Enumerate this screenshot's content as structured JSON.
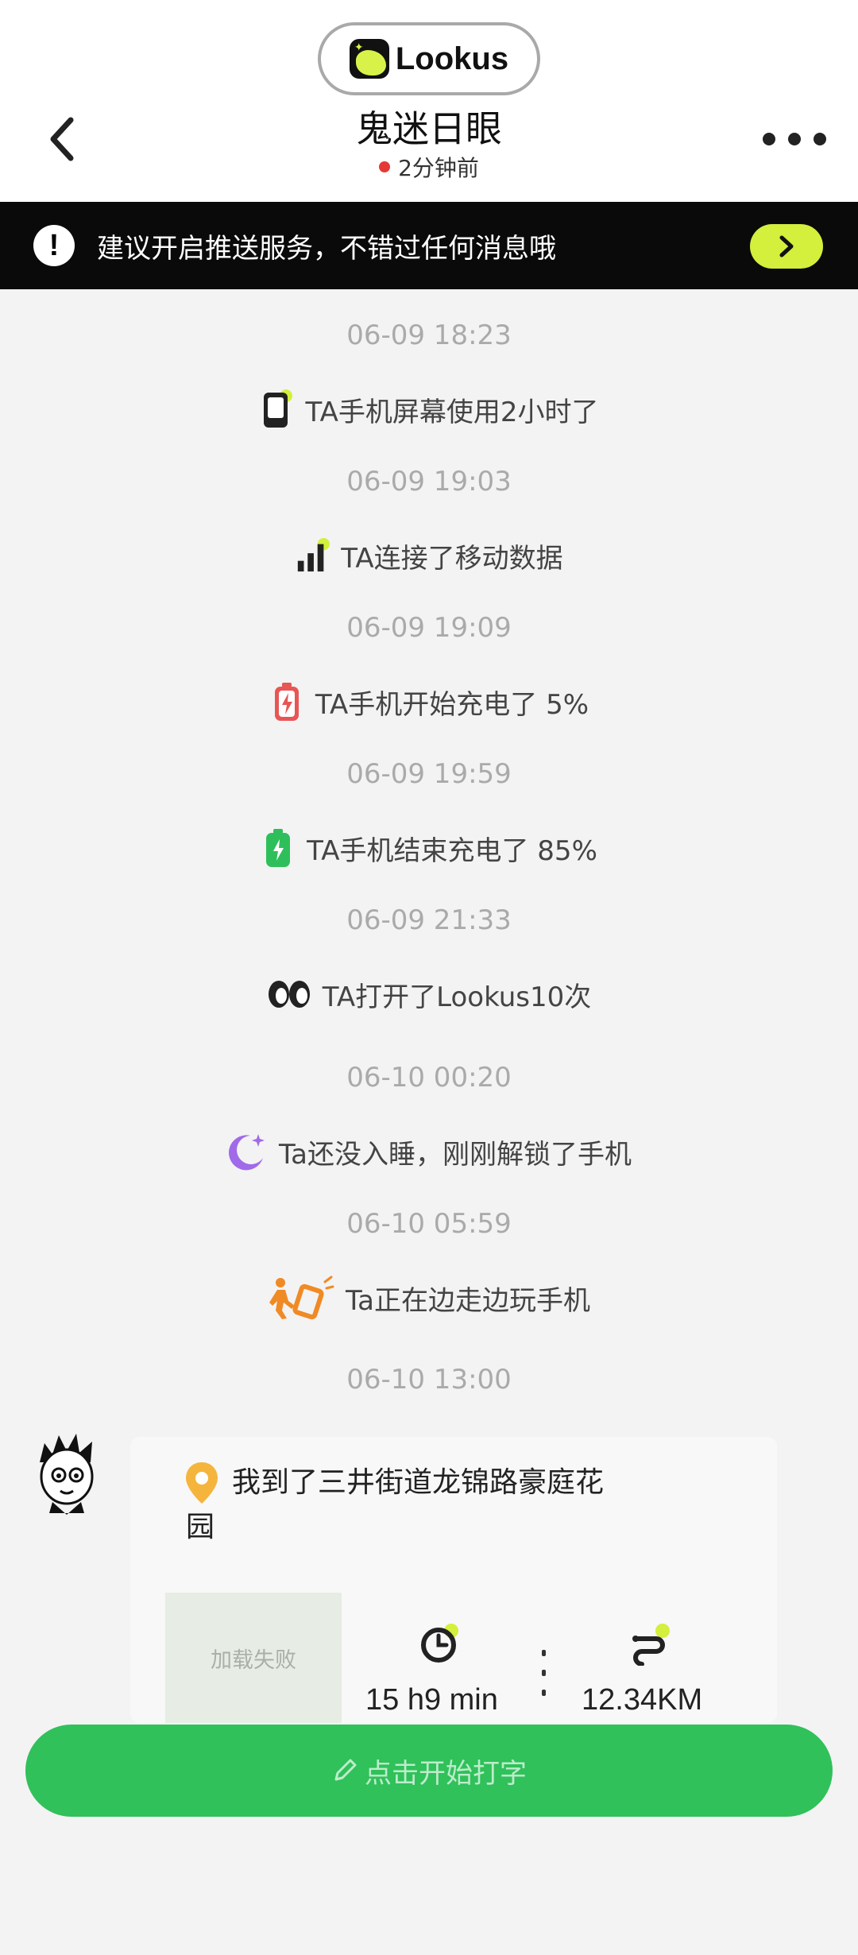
{
  "header": {
    "brand": "Lookus",
    "title": "鬼迷日眼",
    "status": "2分钟前"
  },
  "banner": {
    "text": "建议开启推送服务，不错过任何消息哦"
  },
  "timeline": [
    {
      "time": "06-09 18:23",
      "icon": "phone-screen-icon",
      "text": "TA手机屏幕使用2小时了"
    },
    {
      "time": "06-09 19:03",
      "icon": "mobile-data-icon",
      "text": "TA连接了移动数据"
    },
    {
      "time": "06-09 19:09",
      "icon": "battery-charging-low-icon",
      "text": "TA手机开始充电了 5%"
    },
    {
      "time": "06-09 19:59",
      "icon": "battery-charged-icon",
      "text": "TA手机结束充电了 85%"
    },
    {
      "time": "06-09 21:33",
      "icon": "eyes-icon",
      "text": "TA打开了Lookus10次"
    },
    {
      "time": "06-10 00:20",
      "icon": "moon-icon",
      "text": "Ta还没入睡，刚刚解锁了手机"
    },
    {
      "time": "06-10 05:59",
      "icon": "walking-phone-icon",
      "text": "Ta正在边走边玩手机"
    }
  ],
  "message": {
    "time": "06-10 13:00",
    "location_text": "我到了三井街道龙锦路豪庭花园",
    "map_status": "加载失败",
    "duration": "15 h9 min",
    "distance": "12.34KM"
  },
  "input": {
    "label": "点击开始打字"
  },
  "colors": {
    "accent_lime": "#d4ef3c",
    "input_green": "#30c15a",
    "status_red": "#e53935"
  }
}
